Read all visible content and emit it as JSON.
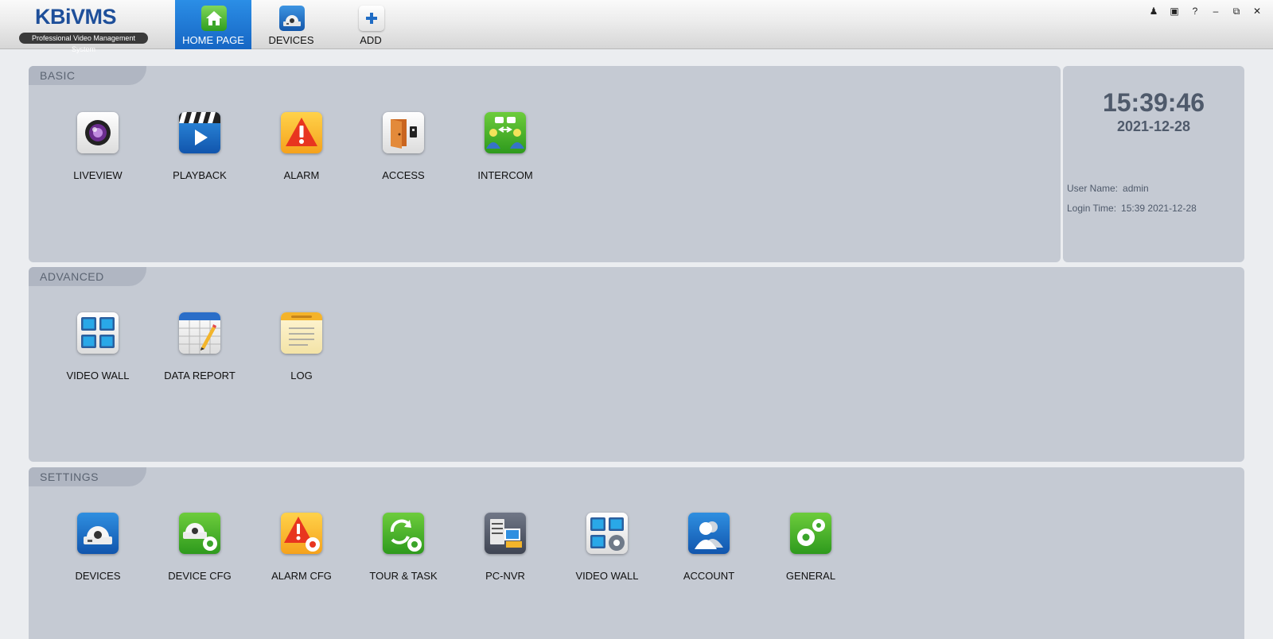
{
  "app": {
    "logo_text": "KBiVMS",
    "logo_subtitle": "Professional Video Management System"
  },
  "nav": {
    "tabs": [
      {
        "label": "HOME PAGE",
        "icon": "home-icon",
        "active": true
      },
      {
        "label": "DEVICES",
        "icon": "camera-icon",
        "active": false
      },
      {
        "label": "ADD",
        "icon": "plus-icon",
        "active": false
      }
    ]
  },
  "window_controls": {
    "user": "♟",
    "lock": "▣",
    "help": "?",
    "minimize": "–",
    "restore": "⧉",
    "close": "✕"
  },
  "basic": {
    "title": "BASIC",
    "items": [
      {
        "label": "LIVEVIEW",
        "icon": "camera-lens-icon"
      },
      {
        "label": "PLAYBACK",
        "icon": "clapperboard-icon"
      },
      {
        "label": "ALARM",
        "icon": "alarm-warning-icon"
      },
      {
        "label": "ACCESS",
        "icon": "door-icon"
      },
      {
        "label": "INTERCOM",
        "icon": "intercom-icon"
      }
    ]
  },
  "advanced": {
    "title": "ADVANCED",
    "items": [
      {
        "label": "VIDEO WALL",
        "icon": "video-wall-icon"
      },
      {
        "label": "DATA REPORT",
        "icon": "data-report-icon"
      },
      {
        "label": "LOG",
        "icon": "log-icon"
      }
    ]
  },
  "settings": {
    "title": "SETTINGS",
    "items": [
      {
        "label": "DEVICES",
        "icon": "dome-camera-icon"
      },
      {
        "label": "DEVICE CFG",
        "icon": "device-cfg-icon"
      },
      {
        "label": "ALARM CFG",
        "icon": "alarm-cfg-icon"
      },
      {
        "label": "TOUR & TASK",
        "icon": "tour-task-icon"
      },
      {
        "label": "PC-NVR",
        "icon": "pc-nvr-icon"
      },
      {
        "label": "VIDEO WALL",
        "icon": "video-wall-cfg-icon"
      },
      {
        "label": "ACCOUNT",
        "icon": "account-icon"
      },
      {
        "label": "GENERAL",
        "icon": "general-gears-icon"
      }
    ]
  },
  "info": {
    "time": "15:39:46",
    "date": "2021-12-28",
    "user_label": "User Name:",
    "user_value": "admin",
    "login_label": "Login Time:",
    "login_value": "15:39 2021-12-28"
  },
  "colors": {
    "accent": "#1a73d2",
    "panel": "#c5cad3",
    "panel_tab": "#b0b6c2",
    "info_text": "#4f5a6b"
  }
}
